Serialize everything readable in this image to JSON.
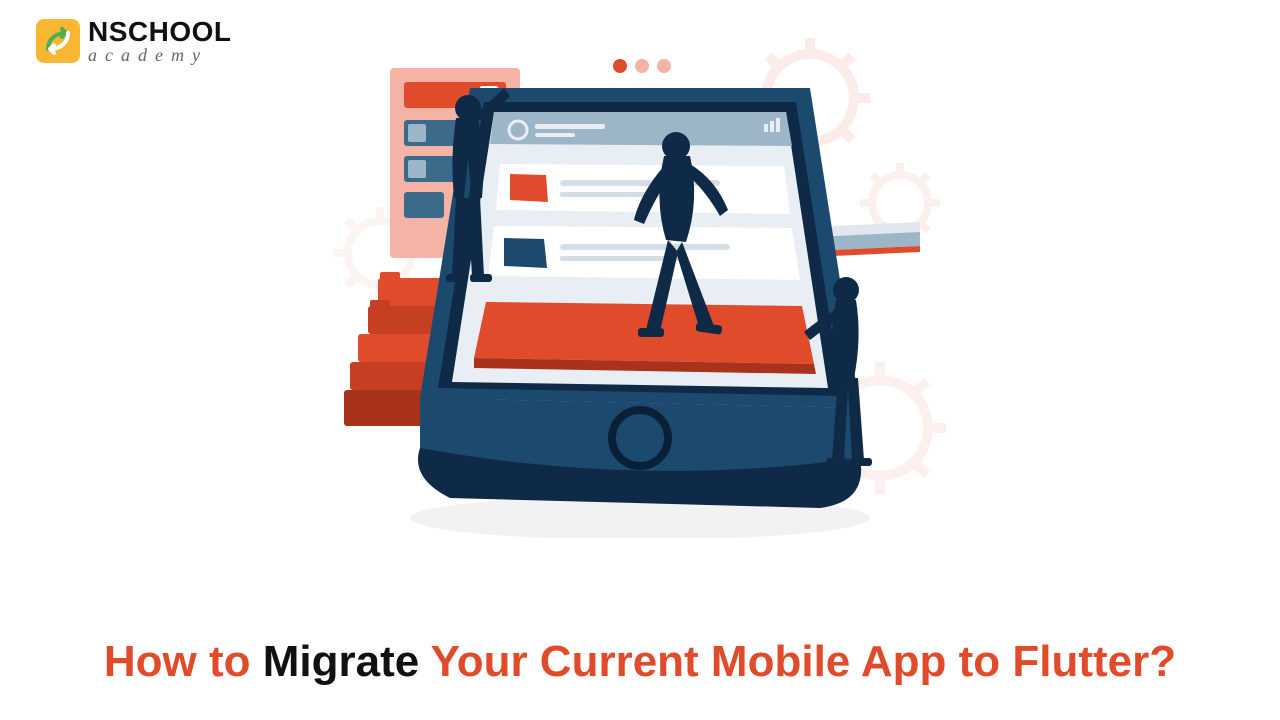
{
  "brand": {
    "line1": "NSCHOOL",
    "line2": "academy"
  },
  "headline": {
    "w1": "How to ",
    "w2": "Migrate ",
    "w3": "Your Current Mobile App to Flutter?"
  },
  "colors": {
    "orange": "#e04c2b",
    "darkNavy": "#0e2a47",
    "navy": "#1c4a6e",
    "coral": "#e04c2b",
    "coralLight": "#f4b3a4",
    "coralPale": "#fdecea",
    "steel": "#3c6a8a",
    "steelLight": "#9db6c7",
    "white": "#ffffff",
    "gray": "#d6dee5"
  }
}
